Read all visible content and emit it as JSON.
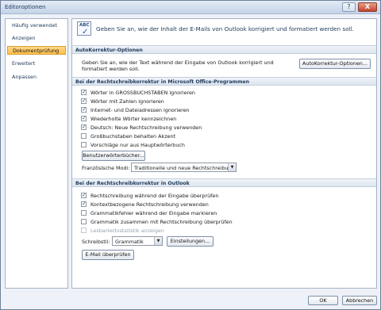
{
  "window": {
    "title": "Editoroptionen",
    "help_symbol": "?",
    "close_symbol": "X"
  },
  "sidebar": {
    "items": [
      {
        "label": "Häufig verwendet"
      },
      {
        "label": "Anzeigen"
      },
      {
        "label": "Dokumentprüfung",
        "selected": true
      },
      {
        "label": "Erweitert"
      },
      {
        "label": "Anpassen"
      }
    ]
  },
  "header": {
    "text": "Geben Sie an, wie der Inhalt der E-Mails von Outlook korrigiert und formatiert werden soll.",
    "icon": "abc-check-icon",
    "icon_text": "ABC"
  },
  "autocorrect": {
    "title": "AutoKorrektur-Optionen",
    "description": "Geben Sie an, wie der Text während der Eingabe von Outlook korrigiert und formatiert werden soll.",
    "button": "AutoKorrektur-Optionen..."
  },
  "office_spelling": {
    "title": "Bei der Rechtschreibkorrektur in Microsoft Office-Programmen",
    "options": [
      {
        "label": "Wörter in GROSSBUCHSTABEN ignorieren",
        "checked": true
      },
      {
        "label": "Wörter mit Zahlen ignorieren",
        "checked": true
      },
      {
        "label": "Internet- und Dateiadressen ignorieren",
        "checked": true
      },
      {
        "label": "Wiederholte Wörter kennzeichnen",
        "checked": true
      },
      {
        "label": "Deutsch: Neue Rechtschreibung verwenden",
        "checked": true
      },
      {
        "label": "Großbuchstaben behalten Akzent",
        "checked": false
      },
      {
        "label": "Vorschläge nur aus Hauptwörterbuch",
        "checked": false
      }
    ],
    "dictionaries_button": "Benutzerwörterbücher...",
    "french_modes_label": "Französische Modi:",
    "french_modes_value": "Traditionelle und neue Rechtschreibung"
  },
  "outlook_spelling": {
    "title": "Bei der Rechtschreibkorrektur in Outlook",
    "options": [
      {
        "label": "Rechtschreibung während der Eingabe überprüfen",
        "checked": true,
        "disabled": false
      },
      {
        "label": "Kontextbezogene Rechtschreibung verwenden",
        "checked": true,
        "disabled": false
      },
      {
        "label": "Grammatikfehler während der Eingabe markieren",
        "checked": false,
        "disabled": false
      },
      {
        "label": "Grammatik zusammen mit Rechtschreibung überprüfen",
        "checked": false,
        "disabled": false
      },
      {
        "label": "Lesbarkeitsstatistik anzeigen",
        "checked": false,
        "disabled": true
      }
    ],
    "writing_style_label": "Schreibstil:",
    "writing_style_value": "Grammatik",
    "settings_button": "Einstellungen...",
    "check_email_button": "E-Mail überprüfen"
  },
  "footer": {
    "ok": "OK",
    "cancel": "Abbrechen"
  },
  "colors": {
    "accent": "#ffbf49",
    "section_text": "#1e395b",
    "window_bg": "#eef2f8"
  }
}
